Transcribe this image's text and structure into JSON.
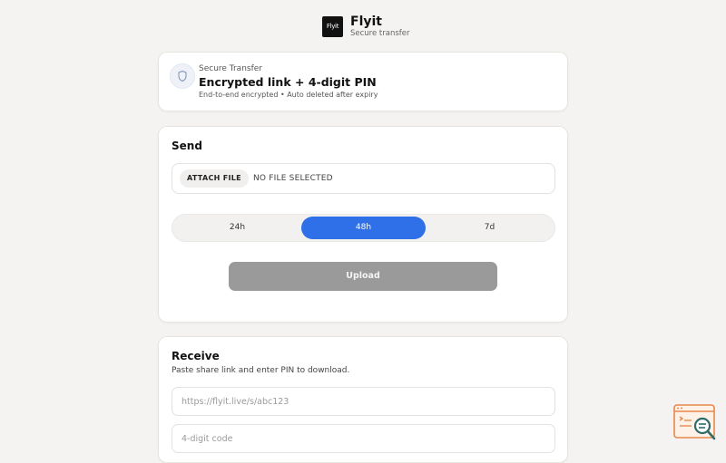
{
  "brand": {
    "logo_text": "Flyit",
    "name": "Flyit",
    "tagline": "Secure transfer"
  },
  "secure_card": {
    "icon": "shield-icon",
    "kicker": "Secure Transfer",
    "title": "Encrypted link + 4-digit PIN",
    "subtitle": "End-to-end encrypted • Auto deleted after expiry"
  },
  "send": {
    "title": "Send",
    "attach_label": "ATTACH FILE",
    "file_status": "NO FILE SELECTED",
    "expiry_options": [
      {
        "label": "24h",
        "active": false
      },
      {
        "label": "48h",
        "active": true
      },
      {
        "label": "7d",
        "active": false
      }
    ],
    "upload_label": "Upload"
  },
  "receive": {
    "title": "Receive",
    "subtitle": "Paste share link and enter PIN to download.",
    "link_placeholder": "https://flyit.live/s/abc123",
    "pin_placeholder": "4-digit code"
  },
  "colors": {
    "accent": "#2f6fe8",
    "disabled_button": "#9a9a9a",
    "page_bg": "#f4f3f1",
    "badge": "#e8884a"
  }
}
